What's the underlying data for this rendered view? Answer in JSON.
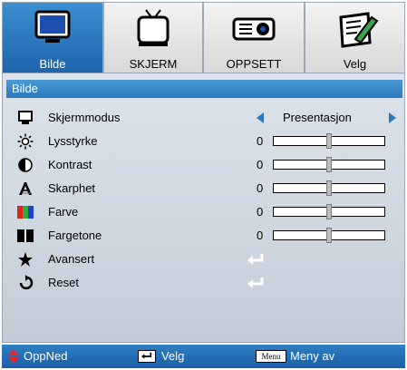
{
  "tabs": [
    {
      "label": "Bilde",
      "icon": "monitor-icon",
      "active": true
    },
    {
      "label": "SKJERM",
      "icon": "tv-icon",
      "active": false
    },
    {
      "label": "OPPSETT",
      "icon": "projector-icon",
      "active": false
    },
    {
      "label": "Velg",
      "icon": "notepad-pen-icon",
      "active": false
    }
  ],
  "section": {
    "title": "Bilde"
  },
  "menu": {
    "display_mode": {
      "label": "Skjermmodus",
      "value": "Presentasjon",
      "icon": "monitor-icon"
    },
    "brightness": {
      "label": "Lysstyrke",
      "value": "0",
      "icon": "sun-icon",
      "level": 0.5
    },
    "contrast": {
      "label": "Kontrast",
      "value": "0",
      "icon": "half-circle-icon",
      "level": 0.5
    },
    "sharpness": {
      "label": "Skarphet",
      "value": "0",
      "icon": "sharpness-icon",
      "level": 0.5
    },
    "color": {
      "label": "Farve",
      "value": "0",
      "icon": "rgb-bars-icon",
      "level": 0.5
    },
    "tint": {
      "label": "Fargetone",
      "value": "0",
      "icon": "bw-bars-icon",
      "level": 0.5
    },
    "advanced": {
      "label": "Avansert",
      "icon": "star-cursor-icon"
    },
    "reset": {
      "label": "Reset",
      "icon": "reset-arrow-icon"
    }
  },
  "footer": {
    "updown": {
      "label": "OppNed",
      "icon": "up-down-icon"
    },
    "select": {
      "label": "Velg",
      "icon": "enter-key-icon"
    },
    "menu": {
      "key": "Menu",
      "label": "Meny av"
    }
  },
  "colors": {
    "accent": "#2c78bc",
    "footer": "#1a5ea8",
    "panel": "#d3dae3"
  }
}
